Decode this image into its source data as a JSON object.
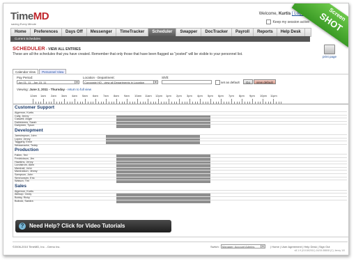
{
  "app": {
    "logo_time": "Time",
    "logo_md": "MD",
    "tagline": "saving Every Minute"
  },
  "welcome": {
    "prefix": "Welcome, ",
    "user": "Kurtis",
    "logout": "[ Logout ]",
    "keep": "Keep my session active"
  },
  "ribbon": {
    "line1": "Screen",
    "line2": "SHOT"
  },
  "nav": {
    "items": [
      "Home",
      "Preferences",
      "Days Off",
      "Messenger",
      "TimeTracker",
      "Scheduler",
      "Swapper",
      "DocTracker",
      "Payroll",
      "Reports",
      "Help Desk"
    ],
    "active": "Scheduler"
  },
  "subnav": {
    "label": "Current Schedules"
  },
  "page": {
    "title": "SCHEDULER",
    "title_sub": " - VIEW ALL ENTRIES",
    "description": "These are all the schedules that you have created. Remember that only those that have been flagged as \"posted\" will be visible to your personnel list.",
    "print": "print page"
  },
  "tabs": [
    "Calendar View",
    "Personnel View"
  ],
  "controls": {
    "pay_period_label": "Pay Period:",
    "pay_period_value": "Jun 01, 11 - Jun 15, 11",
    "location_label": "Location - Department:",
    "location_value": "Corporate HQ - view all Departments in Location",
    "shift_label": "Shift:",
    "shift_value": "",
    "set_default": "set as default",
    "go": "Go",
    "view_default": "view default"
  },
  "viewing": {
    "prefix": "Viewing: ",
    "date": "June 2, 2011 - Thursday",
    "suffix": " - ",
    "link": "return to full view"
  },
  "hours": [
    "12am",
    "1am",
    "2am",
    "3am",
    "4am",
    "5am",
    "6am",
    "7am",
    "8am",
    "9am",
    "10am",
    "11am",
    "12pm",
    "1pm",
    "2pm",
    "3pm",
    "4pm",
    "5pm",
    "6pm",
    "7pm",
    "8pm",
    "9pm",
    "10pm",
    "11pm"
  ],
  "groups": [
    {
      "name": "Customer Support",
      "rows": [
        {
          "name": "Algernon, Kurtis",
          "start": "",
          "end": ""
        },
        {
          "name": "Cally, Jenny",
          "start": "8am",
          "end": "5pm"
        },
        {
          "name": "Caswell, Angie",
          "start": "8am",
          "end": "5pm"
        },
        {
          "name": "Dahlstorms, Sarah",
          "start": "8am",
          "end": "5pm"
        },
        {
          "name": "Dalrymen, Tyson",
          "start": "8am",
          "end": "5pm"
        }
      ]
    },
    {
      "name": "Development",
      "rows": [
        {
          "name": "Jamsimpson, John",
          "start": "7am",
          "end": "4pm"
        },
        {
          "name": "Lopez, Jenny",
          "start": "7am",
          "end": "4pm"
        },
        {
          "name": "Taggarty, Ernie",
          "start": "7am",
          "end": "4pm"
        },
        {
          "name": "Weissmarke, Teddy",
          "start": "",
          "end": ""
        }
      ]
    },
    {
      "name": "Production",
      "rows": [
        {
          "name": "Fallen, Ted",
          "start": "8am",
          "end": "5pm"
        },
        {
          "name": "Fredrickson, Jim",
          "start": "8am",
          "end": "5pm"
        },
        {
          "name": "Hawkins, Jenny",
          "start": "8am",
          "end": "5pm"
        },
        {
          "name": "Lundstrom, Allen",
          "start": "8am",
          "end": "5pm"
        },
        {
          "name": "Marshall, John",
          "start": "8am",
          "end": "5pm"
        },
        {
          "name": "Marshalson, Jimmy",
          "start": "8am",
          "end": "5pm"
        },
        {
          "name": "Sampson, John",
          "start": "8am",
          "end": "5pm"
        },
        {
          "name": "Simmonsen, Eric",
          "start": "8am",
          "end": "5pm"
        },
        {
          "name": "Watson, Tim",
          "start": "8am",
          "end": "5pm"
        }
      ]
    },
    {
      "name": "Sales",
      "rows": [
        {
          "name": "Algernon, Kurtis",
          "start": "",
          "end": ""
        },
        {
          "name": "Allesop, Cindy",
          "start": "8am",
          "end": "5pm"
        },
        {
          "name": "Bobby, Ricky",
          "start": "8am",
          "end": "5pm"
        },
        {
          "name": "Bullock, Sandra",
          "start": "8am",
          "end": "5pm"
        }
      ]
    }
  ],
  "help": {
    "label": "Need Help? Click for Video Tutorials"
  },
  "footer": {
    "copyright": "©2006-2010 TimeMD, Inc. - Demo Inc.",
    "switch_label": "Switch:",
    "switch_value": "Manager: Account Admins",
    "links": "| Home | User Agreement | Help Desk | Sign Out",
    "version": "v8.1.9 (01/18/2011) 16/15:38808 (C) Jenny 1/0"
  },
  "colors": {
    "accent": "#c0262c",
    "bar": "#8e8e8e",
    "group": "#1a3a6a",
    "link": "#1a4c9a"
  }
}
